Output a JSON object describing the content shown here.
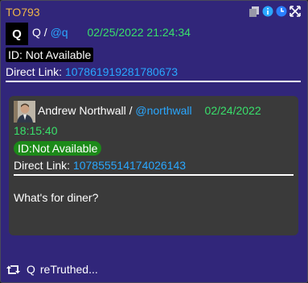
{
  "post": {
    "id_label": "TO793",
    "avatar_letter": "Q",
    "author": "Q",
    "separator": "/",
    "handle": "@q",
    "datetime": "02/25/2022 21:24:34",
    "id_text": "ID: Not Available",
    "direct_link_label": "Direct Link:",
    "direct_link": "107861919281780673"
  },
  "quoted": {
    "author": "Andrew Northwall",
    "separator": "/",
    "handle": "@northwall",
    "date": "02/24/2022",
    "time": "18:15:40",
    "id_text": "ID:Not Available",
    "direct_link_label": "Direct Link:",
    "direct_link": "107855514174026143",
    "body": "What's for diner?"
  },
  "footer": {
    "retruth_user": "Q",
    "retruth_text": "reTruthed..."
  },
  "colors": {
    "card_bg": "#31267a",
    "post_id": "#f0b64a",
    "link": "#2aa7ff",
    "date": "#39e06b",
    "quote_bg": "#3a3a3a",
    "id_badge_green": "#1c8a19"
  },
  "icons": [
    "copy-icon",
    "info-icon",
    "clock-icon",
    "expand-icon",
    "retruth-icon"
  ]
}
